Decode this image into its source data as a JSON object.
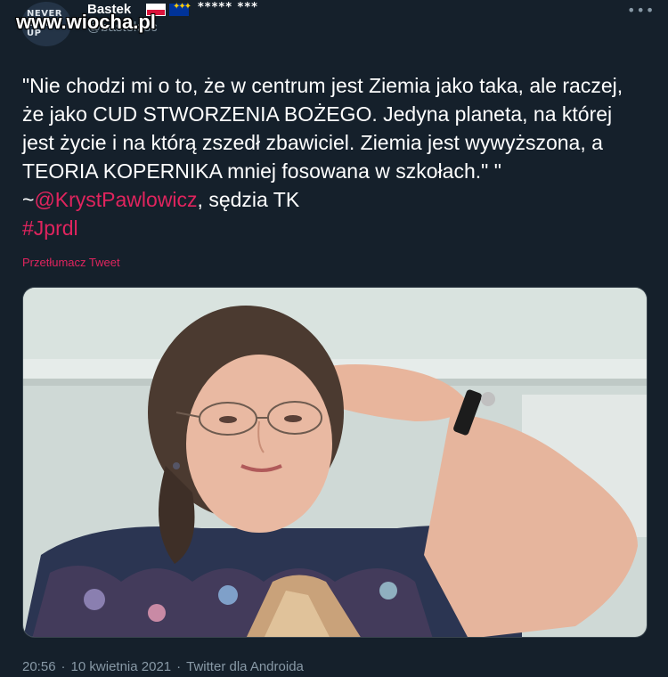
{
  "header": {
    "avatar_text": "NEVER\nGIVE\nUP",
    "display_name": "Bastek",
    "stars": "***** ***",
    "handle": "@bastek.sc",
    "watermark": "www.wiocha.pl",
    "more": "•••"
  },
  "tweet": {
    "text_part1": "\"Nie chodzi mi o to, że w centrum jest Ziemia jako taka, ale raczej, że jako CUD STWORZENIA BOŻEGO. Jedyna planeta, na której jest życie i na którą zszedł zbawiciel. Ziemia jest wywyższona, a TEORIA KOPERNIKA mniej fosowana w szkołach.\" \" ~",
    "mention": "@KrystPawlowicz",
    "text_part2": ", sędzia TK",
    "hashtag": "#Jprdl",
    "translate": "Przetłumacz Tweet"
  },
  "meta": {
    "time": "20:56",
    "sep1": "·",
    "date": "10 kwietnia 2021",
    "sep2": "·",
    "source": "Twitter dla Androida"
  },
  "colors": {
    "background": "#15202b",
    "accent": "#e0245e",
    "secondary_text": "#8899a6"
  }
}
